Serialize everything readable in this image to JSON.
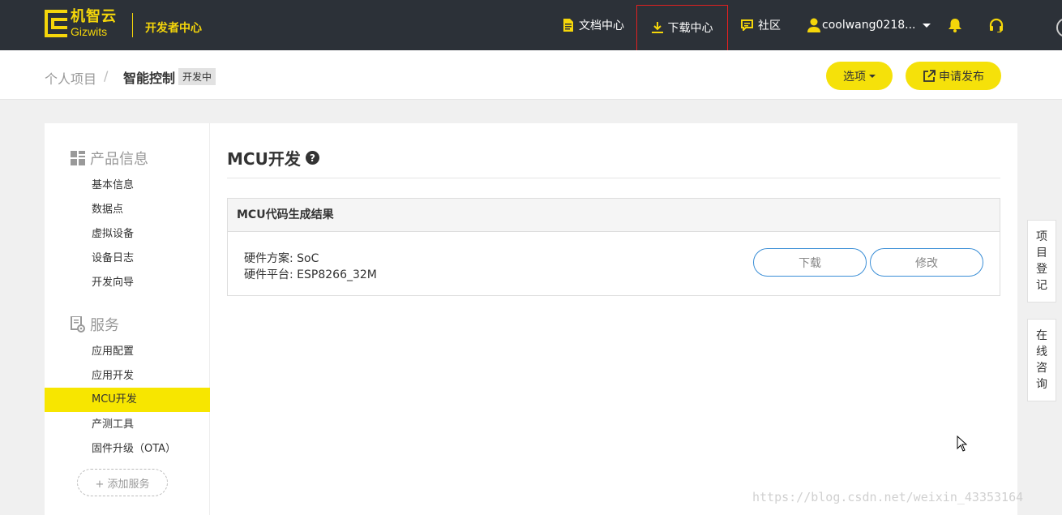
{
  "header": {
    "logo_cn": "机智云",
    "logo_en": "Gizwits",
    "dev_center": "开发者中心",
    "nav": {
      "docs": "文档中心",
      "download": "下载中心",
      "community": "社区",
      "user": "coolwang0218..."
    }
  },
  "breadcrumb": {
    "parent": "个人项目",
    "separator": "/",
    "current": "智能控制",
    "status": "开发中",
    "options_label": "选项",
    "publish_label": "申请发布"
  },
  "sidebar": {
    "product_section": "产品信息",
    "product_items": [
      {
        "label": "基本信息"
      },
      {
        "label": "数据点"
      },
      {
        "label": "虚拟设备"
      },
      {
        "label": "设备日志"
      },
      {
        "label": "开发向导"
      }
    ],
    "service_section": "服务",
    "service_items": [
      {
        "label": "应用配置"
      },
      {
        "label": "应用开发"
      },
      {
        "label": "MCU开发"
      },
      {
        "label": "产测工具"
      },
      {
        "label": "固件升级（OTA）"
      }
    ],
    "add_service": "+ 添加服务"
  },
  "main": {
    "title": "MCU开发",
    "panel_title": "MCU代码生成结果",
    "hw_scheme_label": "硬件方案: SoC",
    "hw_platform_label": "硬件平台: ESP8266_32M",
    "download_label": "下载",
    "edit_label": "修改"
  },
  "float_tabs": {
    "register": [
      "项",
      "目",
      "登",
      "记"
    ],
    "consult": [
      "在",
      "线",
      "咨",
      "询"
    ]
  },
  "watermark": "https://blog.csdn.net/weixin_43353164",
  "colors": {
    "topbar": "#2c3138",
    "accent_yellow": "#f5e10a",
    "active_item": "#f7e600",
    "outline_blue": "#3a8ed6"
  }
}
